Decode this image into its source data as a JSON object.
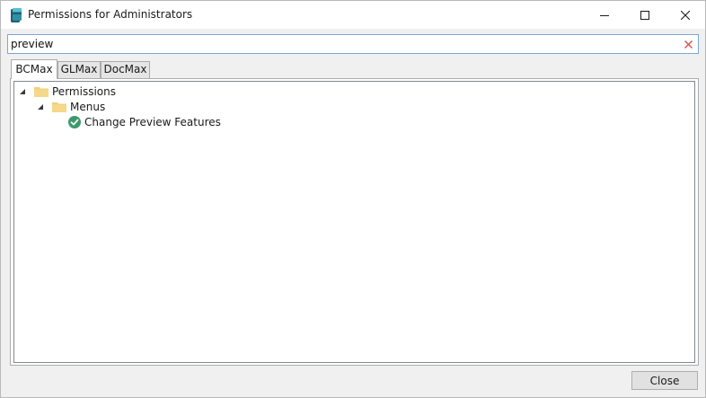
{
  "window": {
    "title": "Permissions for Administrators"
  },
  "search": {
    "value": "preview"
  },
  "tabs": [
    {
      "label": "BCMax",
      "active": true
    },
    {
      "label": "GLMax",
      "active": false
    },
    {
      "label": "DocMax",
      "active": false
    }
  ],
  "tree": {
    "root": {
      "label": "Permissions",
      "icon": "folder-icon",
      "expanded": true
    },
    "child": {
      "label": "Menus",
      "icon": "folder-icon",
      "expanded": true
    },
    "leaf": {
      "label": "Change Preview Features",
      "icon": "check-circle-icon"
    }
  },
  "footer": {
    "close_label": "Close"
  },
  "colors": {
    "folder": "#f0cf7a",
    "check": "#3a9a6a",
    "clear_x": "#d9534f",
    "focus_border": "#7aa7d6"
  }
}
